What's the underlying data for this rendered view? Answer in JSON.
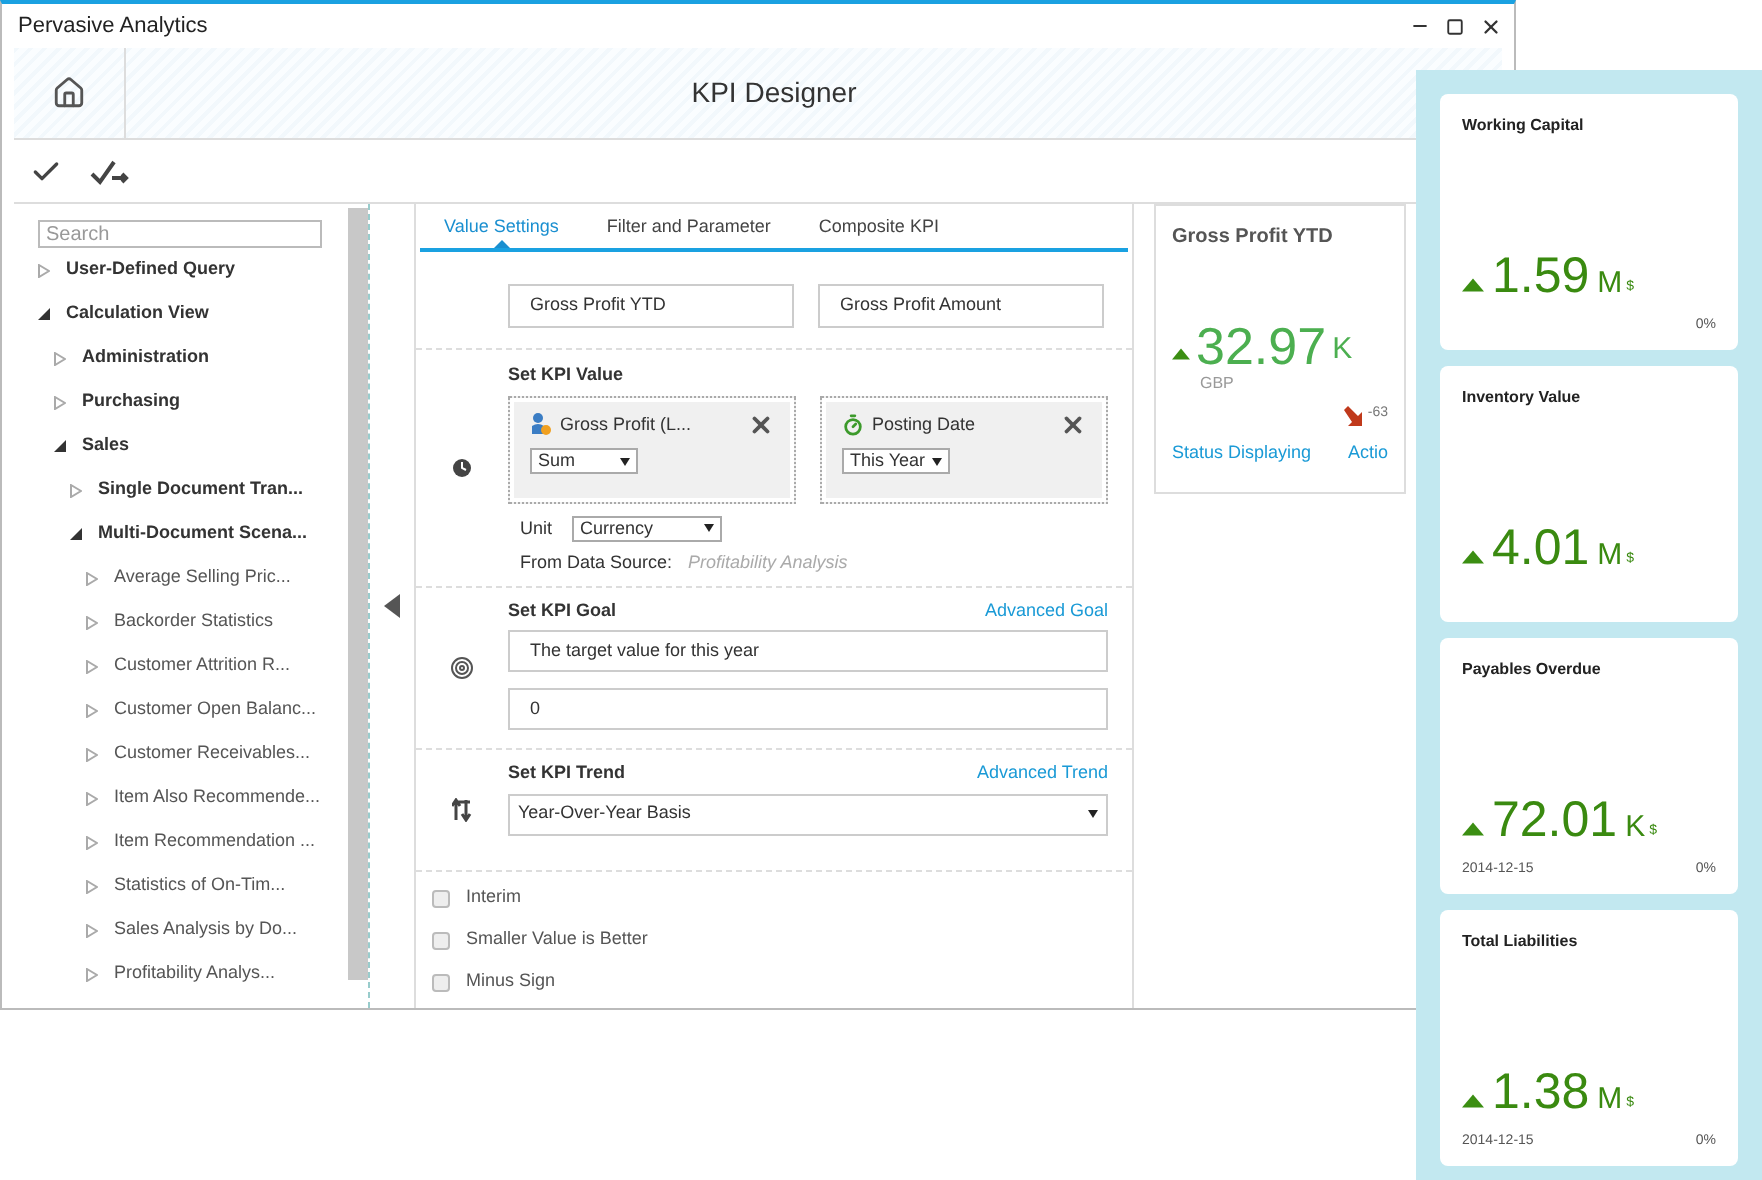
{
  "window": {
    "title": "Pervasive Analytics",
    "header_title": "KPI Designer"
  },
  "sidebar": {
    "search_placeholder": "Search",
    "tree": [
      {
        "label": "User-Defined Query",
        "expanded": false
      },
      {
        "label": "Calculation View",
        "expanded": true,
        "children": [
          {
            "label": "Administration",
            "expanded": false
          },
          {
            "label": "Purchasing",
            "expanded": false
          },
          {
            "label": "Sales",
            "expanded": true,
            "children": [
              {
                "label": "Single Document Tran...",
                "expanded": false
              },
              {
                "label": "Multi-Document Scena...",
                "expanded": true,
                "children": [
                  {
                    "label": "Average Selling Pric...",
                    "expanded": false
                  },
                  {
                    "label": "Backorder Statistics",
                    "expanded": false
                  },
                  {
                    "label": "Customer Attrition R...",
                    "expanded": false
                  },
                  {
                    "label": "Customer Open Balanc...",
                    "expanded": false
                  },
                  {
                    "label": "Customer Receivables...",
                    "expanded": false
                  },
                  {
                    "label": "Item Also Recommende...",
                    "expanded": false
                  },
                  {
                    "label": "Item Recommendation ...",
                    "expanded": false
                  },
                  {
                    "label": "Statistics of On-Tim...",
                    "expanded": false
                  },
                  {
                    "label": "Sales Analysis by Do...",
                    "expanded": false
                  },
                  {
                    "label": "Profitability Analys...",
                    "expanded": false
                  }
                ]
              }
            ]
          }
        ]
      }
    ]
  },
  "tabs": [
    {
      "label": "Value Settings",
      "selected": true
    },
    {
      "label": "Filter and Parameter",
      "selected": false
    },
    {
      "label": "Composite KPI",
      "selected": false
    }
  ],
  "form": {
    "name": "Gross Profit YTD",
    "description": "Gross Profit Amount",
    "value_section": {
      "label": "Set KPI Value",
      "fields": [
        {
          "kind": "measure",
          "name": "Gross Profit (L...",
          "aggregate": "Sum"
        },
        {
          "kind": "date",
          "name": "Posting Date",
          "aggregate": "This Year"
        }
      ],
      "unit_label": "Unit",
      "unit": "Currency",
      "source_label": "From Data Source:",
      "source": "Profitability Analysis"
    },
    "goal_section": {
      "label": "Set KPI Goal",
      "link": "Advanced Goal",
      "description": "The target value for this year",
      "value": "0"
    },
    "trend_section": {
      "label": "Set KPI Trend",
      "link": "Advanced Trend",
      "value": "Year-Over-Year Basis"
    },
    "options": [
      {
        "label": "Interim",
        "checked": false
      },
      {
        "label": "Smaller Value is Better",
        "checked": false
      },
      {
        "label": "Minus Sign",
        "checked": false
      }
    ]
  },
  "preview": {
    "title": "Gross Profit YTD",
    "value": "32.97",
    "unit": "K",
    "currency": "GBP",
    "change": "-63",
    "status_link": "Status Displaying",
    "action_link": "Actio"
  },
  "tiles": [
    {
      "title": "Working Capital",
      "value": "1.59",
      "unit": "M",
      "currency": "$",
      "change": "0%"
    },
    {
      "title": "Inventory Value",
      "value": "4.01",
      "unit": "M",
      "currency": "$"
    },
    {
      "title": "Payables Overdue",
      "value": "72.01",
      "unit": "K",
      "currency": "$",
      "date": "2014-12-15",
      "change": "0%"
    },
    {
      "title": "Total Liabilities",
      "value": "1.38",
      "unit": "M",
      "currency": "$",
      "date": "2014-12-15",
      "change": "0%"
    }
  ]
}
